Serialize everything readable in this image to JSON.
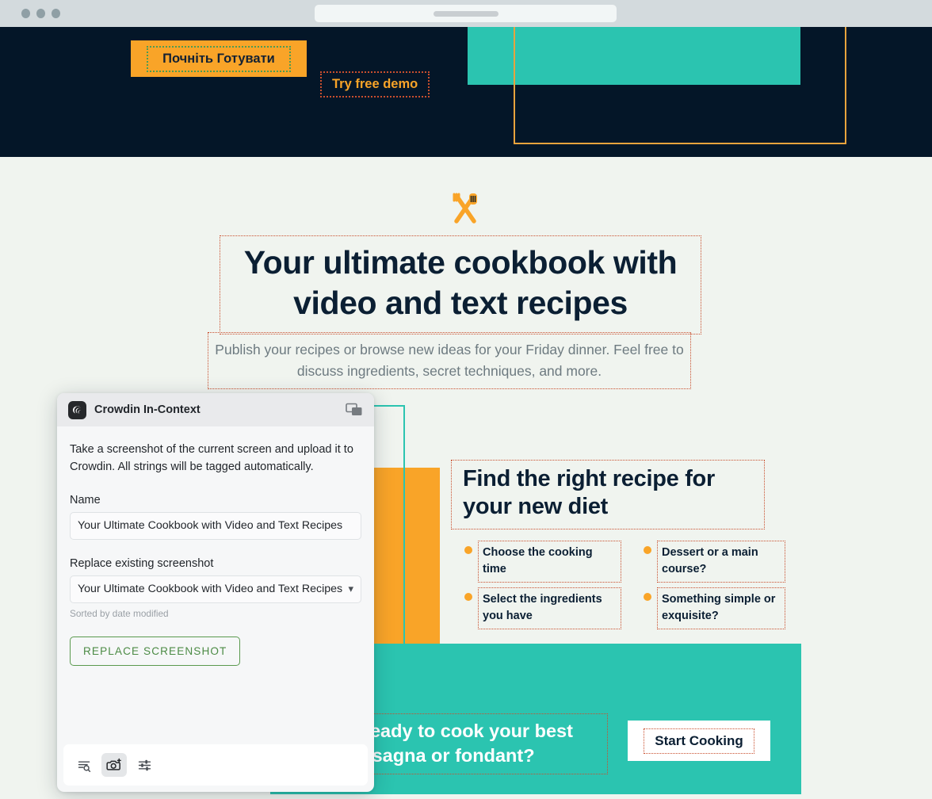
{
  "browser": {
    "traffic_lights": [
      "close",
      "minimize",
      "maximize"
    ],
    "address_placeholder": ""
  },
  "hero": {
    "primary_button": "Почніть Готувати",
    "secondary_button": "Try free demo",
    "colors": {
      "background": "#041628",
      "orange": "#f9a428",
      "teal": "#2bc4b0",
      "translated_outline": "#4e9a52",
      "untranslated_outline": "#c94f2e"
    }
  },
  "main": {
    "icon_name": "crossed-fork-and-spatula-icon",
    "heading": "Your ultimate cookbook with video and text recipes",
    "subtitle": "Publish your recipes or browse new ideas for your Friday dinner. Feel free to discuss ingredients, secret techniques, and more.",
    "find_heading": "Find the right recipe for your new diet",
    "features": [
      "Choose the cooking time",
      "Dessert or a main course?",
      "Select the ingredients you have",
      "Something simple or exquisite?"
    ],
    "cta_text": "Ready to cook your best lasagna or fondant?",
    "cta_button": "Start Cooking"
  },
  "dialog": {
    "title": "Crowdin In-Context",
    "logo_name": "crowdin-logo-icon",
    "window_icon_name": "restore-window-icon",
    "description": "Take a screenshot of the current screen and upload it to Crowdin. All strings will be tagged automatically.",
    "name_label": "Name",
    "name_value": "Your Ultimate Cookbook with Video and Text Recipes",
    "replace_label": "Replace existing screenshot",
    "replace_value": "Your Ultimate Cookbook with Video and Text Recipes",
    "sorted_note": "Sorted by date modified",
    "replace_button": "REPLACE SCREENSHOT",
    "toolbar": [
      {
        "name": "search-strings-icon",
        "active": false
      },
      {
        "name": "camera-screenshot-icon",
        "active": true
      },
      {
        "name": "settings-sliders-icon",
        "active": false
      }
    ]
  }
}
